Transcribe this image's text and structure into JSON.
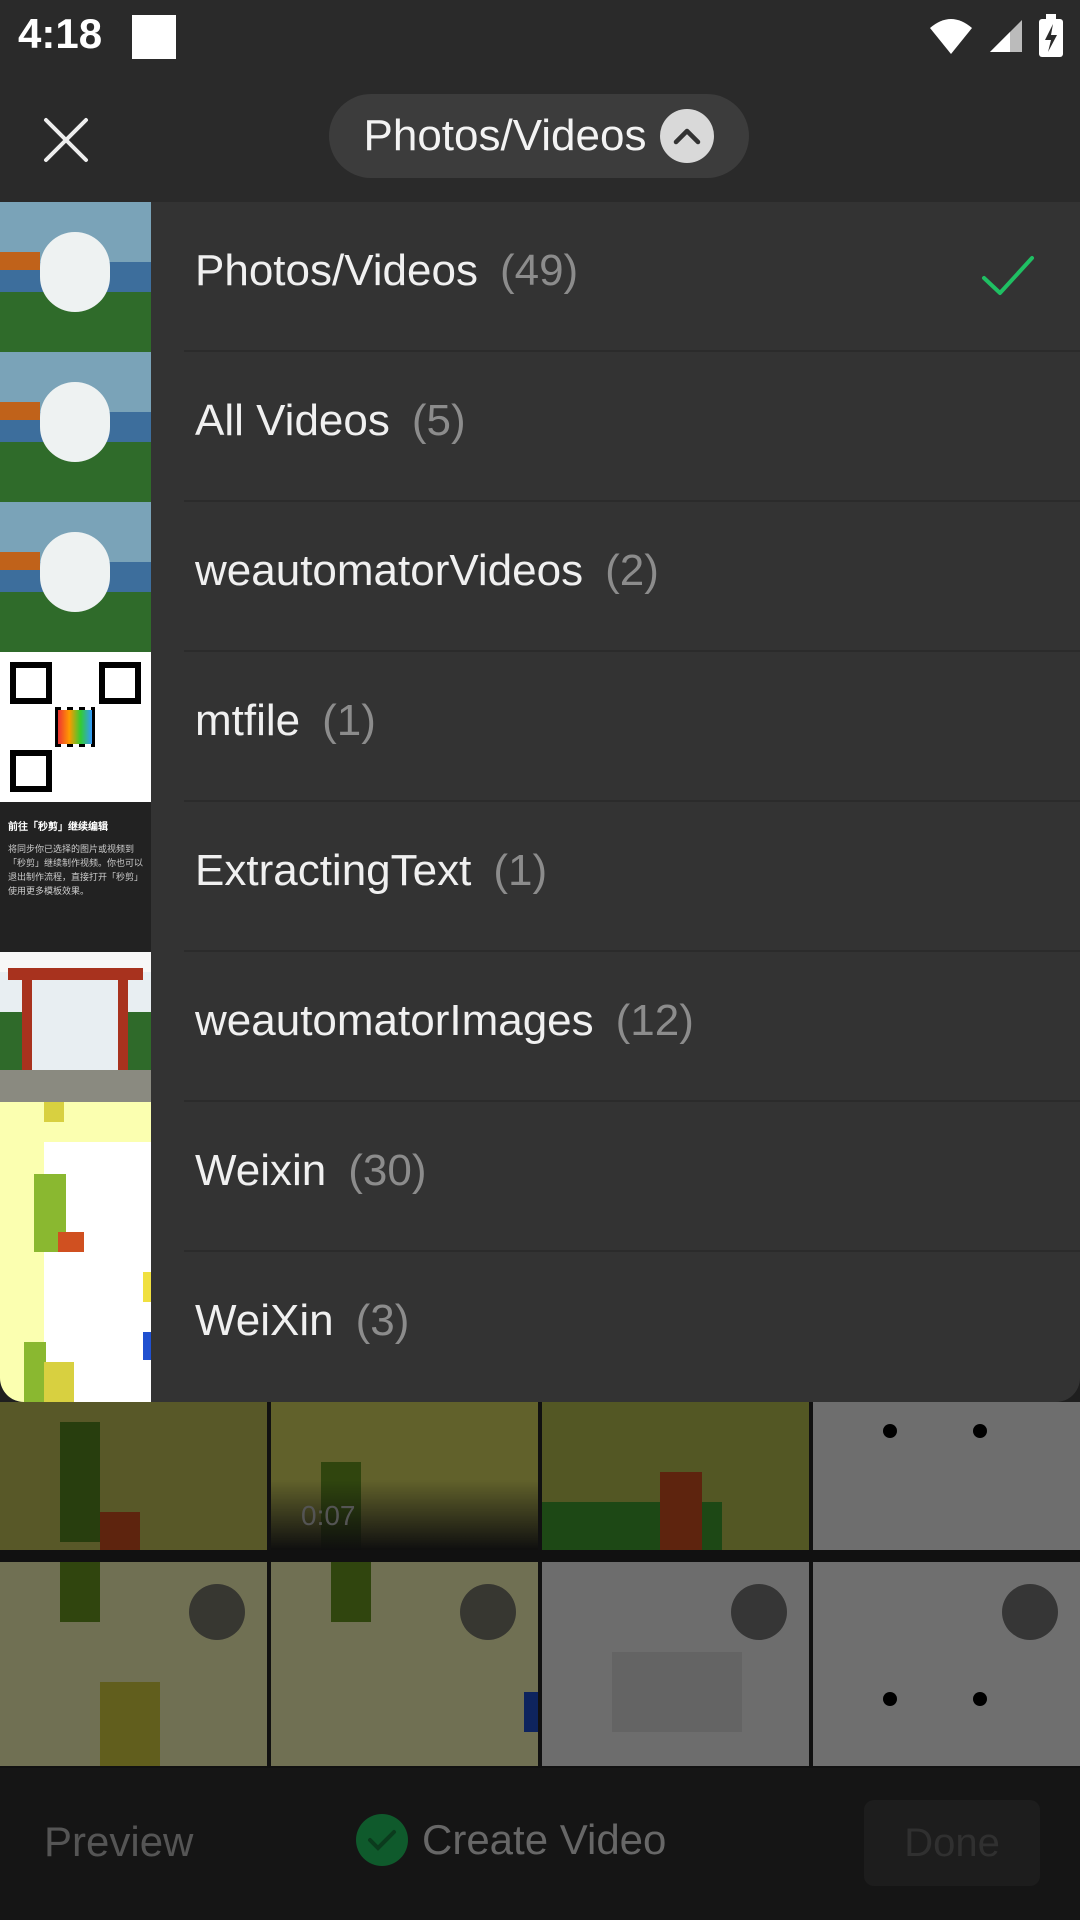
{
  "status_bar": {
    "time": "4:18"
  },
  "header": {
    "album_title": "Photos/Videos"
  },
  "albums": [
    {
      "name": "Photos/Videos",
      "count": "(49)",
      "selected": true
    },
    {
      "name": "All Videos",
      "count": "(5)"
    },
    {
      "name": "weautomatorVideos",
      "count": "(2)"
    },
    {
      "name": "mtfile",
      "count": "(1)"
    },
    {
      "name": "ExtractingText",
      "count": "(1)"
    },
    {
      "name": "weautomatorImages",
      "count": "(12)"
    },
    {
      "name": "Weixin",
      "count": "(30)"
    },
    {
      "name": "WeiXin",
      "count": "(3)"
    }
  ],
  "thumb_text": {
    "extract_title": "前往「秒剪」继续编辑",
    "extract_body": "将同步你已选择的图片或视频到「秒剪」继续制作视频。你也可以退出制作流程，直接打开「秒剪」使用更多模板效果。"
  },
  "grid": {
    "video_duration": "0:07"
  },
  "bottom_bar": {
    "preview_label": "Preview",
    "create_video_label": "Create Video",
    "done_label": "Done"
  },
  "colors": {
    "accent_green": "#1fbf63",
    "dropdown_bg": "#333333"
  }
}
